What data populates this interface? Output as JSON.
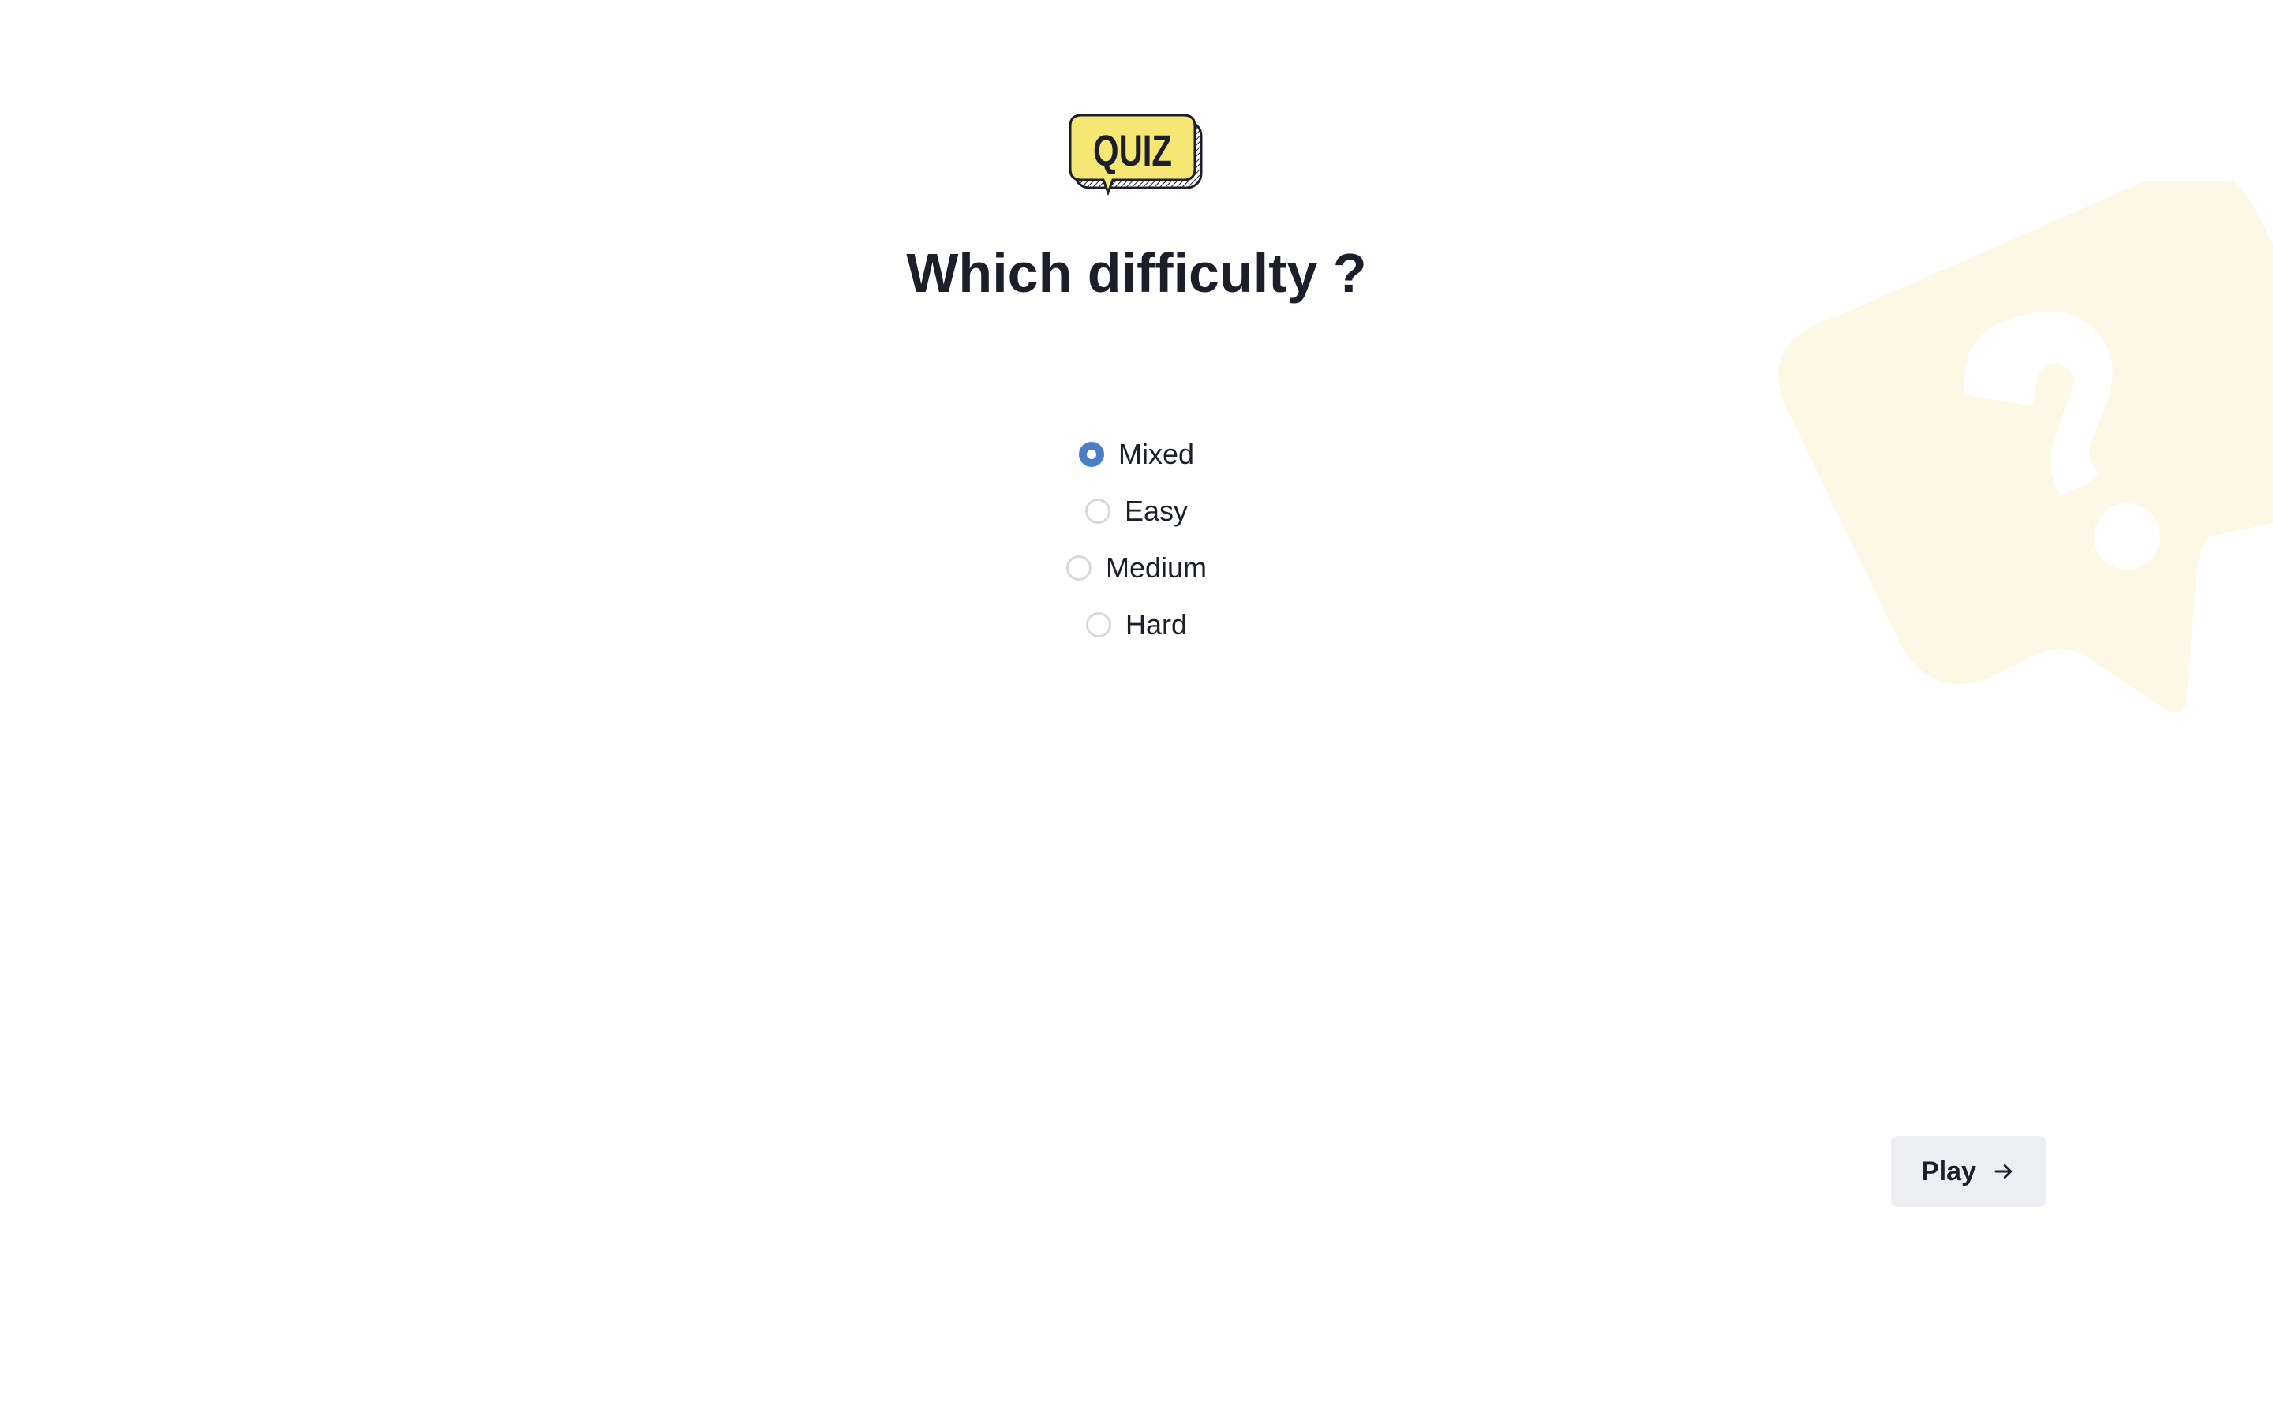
{
  "logo": {
    "text": "QUIZ",
    "icon": "quiz-speech-bubble-logo"
  },
  "heading": "Which difficulty ?",
  "difficulty": {
    "selected": "Mixed",
    "options": [
      {
        "label": "Mixed",
        "checked": true
      },
      {
        "label": "Easy",
        "checked": false
      },
      {
        "label": "Medium",
        "checked": false
      },
      {
        "label": "Hard",
        "checked": false
      }
    ]
  },
  "play_button": {
    "label": "Play",
    "icon": "arrow-right-icon"
  },
  "colors": {
    "accent": "#4a7fc7",
    "logo_yellow": "#f6e774",
    "background_bubble": "#fdf8e6",
    "text": "#1c1f2a",
    "button_bg": "#eceef1"
  }
}
